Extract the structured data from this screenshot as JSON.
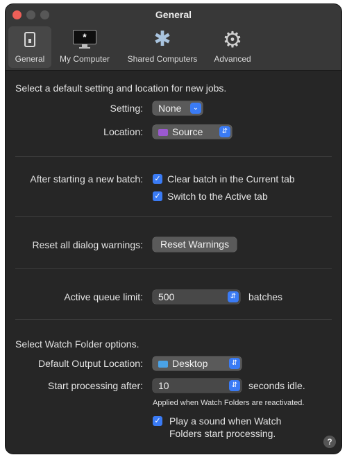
{
  "window": {
    "title": "General"
  },
  "toolbar": {
    "items": [
      {
        "label": "General",
        "icon": "general-switch-icon"
      },
      {
        "label": "My Computer",
        "icon": "monitor-icon"
      },
      {
        "label": "Shared Computers",
        "icon": "asterisk-network-icon"
      },
      {
        "label": "Advanced",
        "icon": "gear-icon"
      }
    ]
  },
  "defaults": {
    "heading": "Select a default setting and location for new jobs.",
    "setting_label": "Setting:",
    "setting_value": "None",
    "location_label": "Location:",
    "location_value": "Source"
  },
  "batch": {
    "label": "After starting a new batch:",
    "clear_label": "Clear batch in the Current tab",
    "clear_checked": true,
    "switch_label": "Switch to the Active tab",
    "switch_checked": true
  },
  "warnings": {
    "label": "Reset all dialog warnings:",
    "button": "Reset Warnings"
  },
  "queue": {
    "label": "Active queue limit:",
    "value": "500",
    "unit": "batches"
  },
  "watch": {
    "heading": "Select Watch Folder options.",
    "output_label": "Default Output Location:",
    "output_value": "Desktop",
    "start_label": "Start processing after:",
    "start_value": "10",
    "start_unit": "seconds idle.",
    "note": "Applied when Watch Folders are reactivated.",
    "sound_line1": "Play a sound when Watch",
    "sound_line2": "Folders start processing.",
    "sound_checked": true
  },
  "help_label": "?",
  "colors": {
    "accent": "#3a7bf5",
    "close": "#ee5f58",
    "background": "#262626",
    "source_folder": "#9b59d0",
    "desktop_folder": "#4aa3e8"
  }
}
